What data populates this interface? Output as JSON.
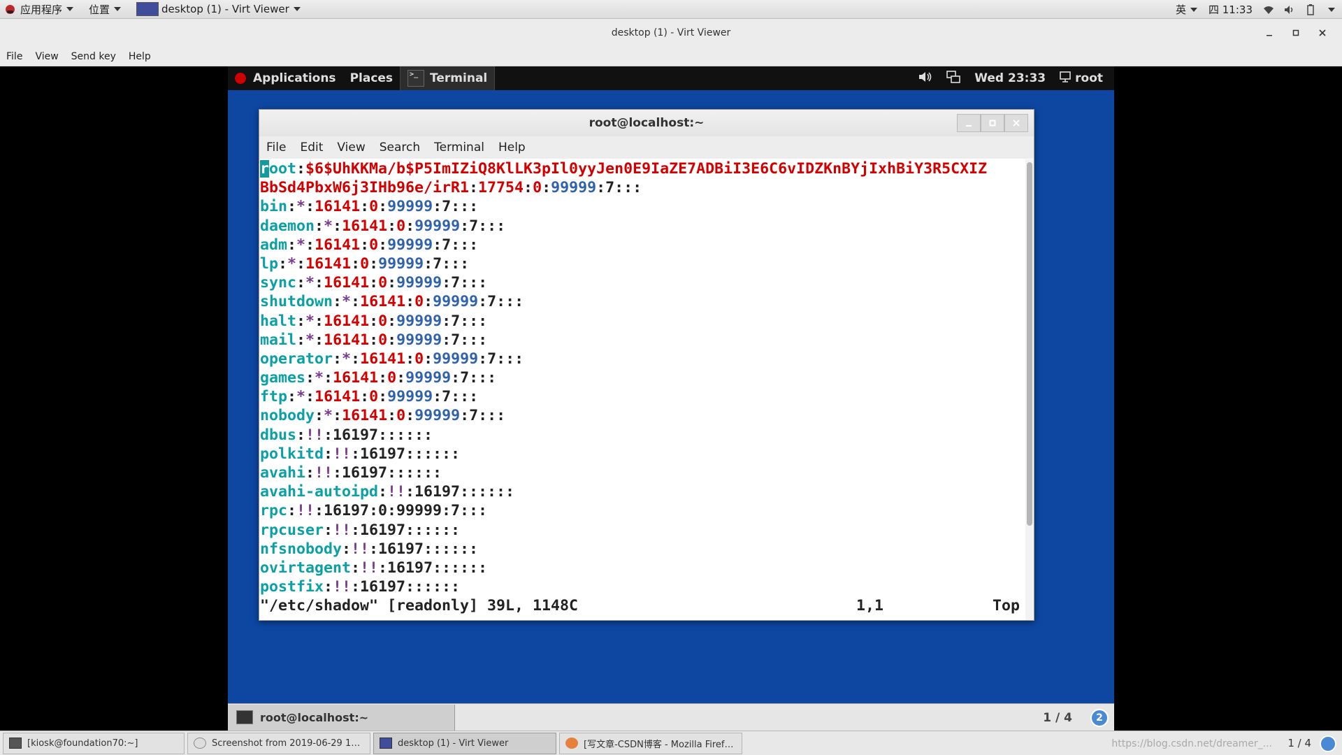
{
  "host_topbar": {
    "applications": "应用程序",
    "places": "位置",
    "window_title": "desktop (1) - Virt Viewer",
    "input_method": "英",
    "clock": "四 11:33"
  },
  "virt_viewer": {
    "title": "desktop (1) - Virt Viewer",
    "menu": [
      "File",
      "View",
      "Send key",
      "Help"
    ]
  },
  "guest_topbar": {
    "applications": "Applications",
    "places": "Places",
    "terminal": "Terminal",
    "clock": "Wed 23:33",
    "user": "root"
  },
  "terminal": {
    "title": "root@localhost:~",
    "menu": [
      "File",
      "Edit",
      "View",
      "Search",
      "Terminal",
      "Help"
    ],
    "root_line_1": {
      "cursor": "r",
      "user": "oot",
      "hash": "$6$UhKKMa/b$P5ImIZiQ8KlLK3pIl0yyJen0E9IaZE7ADBiI3E6C6vIDZKnBYjIxhBiY3R5CXIZ"
    },
    "root_line_2": {
      "hash": "BbSd4PbxW6j3IHb96e/irR1",
      "lastchg": "17754",
      "min": "0",
      "max": "99999",
      "tail": ":7:::"
    },
    "star_entries": [
      {
        "user": "bin",
        "pw": "*",
        "lastchg": "16141",
        "min": "0",
        "max": "99999",
        "tail": ":7:::"
      },
      {
        "user": "daemon",
        "pw": "*",
        "lastchg": "16141",
        "min": "0",
        "max": "99999",
        "tail": ":7:::"
      },
      {
        "user": "adm",
        "pw": "*",
        "lastchg": "16141",
        "min": "0",
        "max": "99999",
        "tail": ":7:::"
      },
      {
        "user": "lp",
        "pw": "*",
        "lastchg": "16141",
        "min": "0",
        "max": "99999",
        "tail": ":7:::"
      },
      {
        "user": "sync",
        "pw": "*",
        "lastchg": "16141",
        "min": "0",
        "max": "99999",
        "tail": ":7:::"
      },
      {
        "user": "shutdown",
        "pw": "*",
        "lastchg": "16141",
        "min": "0",
        "max": "99999",
        "tail": ":7:::"
      },
      {
        "user": "halt",
        "pw": "*",
        "lastchg": "16141",
        "min": "0",
        "max": "99999",
        "tail": ":7:::"
      },
      {
        "user": "mail",
        "pw": "*",
        "lastchg": "16141",
        "min": "0",
        "max": "99999",
        "tail": ":7:::"
      },
      {
        "user": "operator",
        "pw": "*",
        "lastchg": "16141",
        "min": "0",
        "max": "99999",
        "tail": ":7:::"
      },
      {
        "user": "games",
        "pw": "*",
        "lastchg": "16141",
        "min": "0",
        "max": "99999",
        "tail": ":7:::"
      },
      {
        "user": "ftp",
        "pw": "*",
        "lastchg": "16141",
        "min": "0",
        "max": "99999",
        "tail": ":7:::"
      },
      {
        "user": "nobody",
        "pw": "*",
        "lastchg": "16141",
        "min": "0",
        "max": "99999",
        "tail": ":7:::"
      }
    ],
    "locked_entries": [
      {
        "user": "dbus",
        "pw": "!!",
        "rest": ":16197::::::"
      },
      {
        "user": "polkitd",
        "pw": "!!",
        "rest": ":16197::::::"
      },
      {
        "user": "avahi",
        "pw": "!!",
        "rest": ":16197::::::"
      },
      {
        "user": "avahi-autoipd",
        "pw": "!!",
        "rest": ":16197::::::"
      },
      {
        "user": "rpc",
        "pw": "!!",
        "rest": ":16197:0:99999:7:::"
      },
      {
        "user": "rpcuser",
        "pw": "!!",
        "rest": ":16197::::::"
      },
      {
        "user": "nfsnobody",
        "pw": "!!",
        "rest": ":16197::::::"
      },
      {
        "user": "ovirtagent",
        "pw": "!!",
        "rest": ":16197::::::"
      },
      {
        "user": "postfix",
        "pw": "!!",
        "rest": ":16197::::::"
      }
    ],
    "status_left": "\"/etc/shadow\" [readonly] 39L, 1148C",
    "status_pos": "1,1",
    "status_scroll": "Top"
  },
  "guest_bottombar": {
    "task": "root@localhost:~",
    "workspace": "1 / 4",
    "badge": "2"
  },
  "host_taskbar": {
    "tasks": [
      "[kiosk@foundation70:~]",
      "Screenshot from 2019-06-29 1…",
      "desktop (1) - Virt Viewer",
      "[写文章-CSDN博客 - Mozilla Firef…"
    ],
    "watermark": "https://blog.csdn.net/dreamer_...",
    "pager": "1 / 4"
  }
}
